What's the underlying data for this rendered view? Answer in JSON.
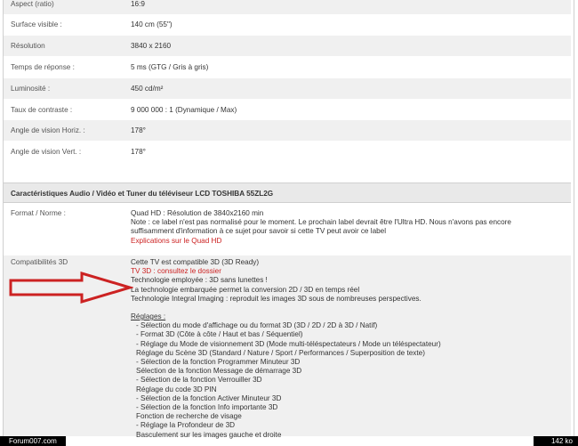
{
  "specs": [
    {
      "label": "Aspect (ratio)",
      "value": "16:9"
    },
    {
      "label": "Surface visible :",
      "value": "140 cm (55\")"
    },
    {
      "label": "Résolution",
      "value": "3840 x 2160"
    },
    {
      "label": "Temps de réponse :",
      "value": "5 ms (GTG / Gris à gris)"
    },
    {
      "label": "Luminosité :",
      "value": "450 cd/m²"
    },
    {
      "label": "Taux de contraste :",
      "value": "9 000 000 : 1 (Dynamique / Max)"
    },
    {
      "label": "Angle de vision Horiz. :",
      "value": "178°"
    },
    {
      "label": "Angle de vision Vert. :",
      "value": "178°"
    }
  ],
  "section_title": "Caractéristiques Audio / Vidéo et Tuner du téléviseur LCD TOSHIBA 55ZL2G",
  "format": {
    "label": "Format / Norme :",
    "line1": "Quad HD : Résolution de 3840x2160 min",
    "line2": "Note : ce label n'est pas normalisé pour le moment. Le prochain label devrait être l'Ultra HD. Nous n'avons pas encore",
    "line3": "suffisamment d'information à ce sujet pour savoir si cette TV peut avoir ce label",
    "link": "Explications sur le Quad HD"
  },
  "compat": {
    "label": "Compatibilités 3D",
    "line1": "Cette TV est compatible 3D (3D Ready)",
    "link": "TV 3D : consultez le dossier",
    "line3": "Technologie employée : 3D sans lunettes !",
    "line4": "La technologie embarquée permet la conversion 2D / 3D en temps réel",
    "line5": "Technologie Integral Imaging : reproduit les images 3D sous de nombreuses perspectives.",
    "settings_title": "Réglages :",
    "settings": [
      "- Sélection du mode d'affichage ou du format 3D (3D / 2D / 2D à 3D / Natif)",
      "- Format 3D (Côte à côte / Haut et bas / Séquentiel)",
      "- Réglage du Mode de visionnement 3D (Mode multi-téléspectateurs / Mode un téléspectateur)",
      "  Réglage du Scène 3D (Standard / Nature / Sport / Performances / Superposition de texte)",
      "- Sélection de la fonction Programmer Minuteur 3D",
      "  Sélection de la fonction Message de démarrage 3D",
      "- Sélection de la fonction Verrouiller 3D",
      "  Réglage du code 3D PIN",
      "- Sélection de la fonction Activer Minuteur 3D",
      "- Sélection de la fonction Info importante 3D",
      "  Fonction de recherche de visage",
      "- Réglage la Profondeur de 3D",
      "  Basculement sur les images gauche et droite"
    ]
  },
  "footer": {
    "site": "Forum007.com",
    "size": "142 ko"
  },
  "colors": {
    "link": "#cc2222",
    "arrow": "#cc2222"
  }
}
